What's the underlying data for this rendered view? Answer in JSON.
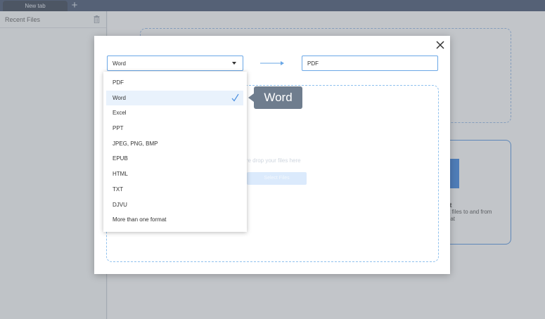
{
  "tabs": [
    {
      "label": "New tab"
    }
  ],
  "new_tab_symbol": "+",
  "sidebar": {
    "title": "Recent Files"
  },
  "background_card": {
    "title": "ert",
    "description": "ert files to and from\nrmat"
  },
  "modal": {
    "from_value": "Word",
    "to_value": "PDF",
    "drop_hint": "ire drop your files here",
    "select_button_label": "Select Files"
  },
  "dropdown": {
    "options": [
      {
        "label": "PDF",
        "selected": false
      },
      {
        "label": "Word",
        "selected": true
      },
      {
        "label": "Excel",
        "selected": false
      },
      {
        "label": "PPT",
        "selected": false
      },
      {
        "label": "JPEG, PNG, BMP",
        "selected": false
      },
      {
        "label": "EPUB",
        "selected": false
      },
      {
        "label": "HTML",
        "selected": false
      },
      {
        "label": "TXT",
        "selected": false
      },
      {
        "label": "DJVU",
        "selected": false
      },
      {
        "label": "More than one format",
        "selected": false
      }
    ]
  },
  "tooltip": {
    "text": "Word"
  },
  "icons": {
    "close": "close-icon",
    "caret": "chevron-down-icon",
    "arrow": "arrow-right-icon",
    "check": "check-icon",
    "trash": "trash-icon"
  },
  "colors": {
    "accent": "#4a8fe0",
    "tab_bar": "#3a4a68",
    "selected_option": "#e9f2fc",
    "tooltip": "#6f7d8e"
  }
}
